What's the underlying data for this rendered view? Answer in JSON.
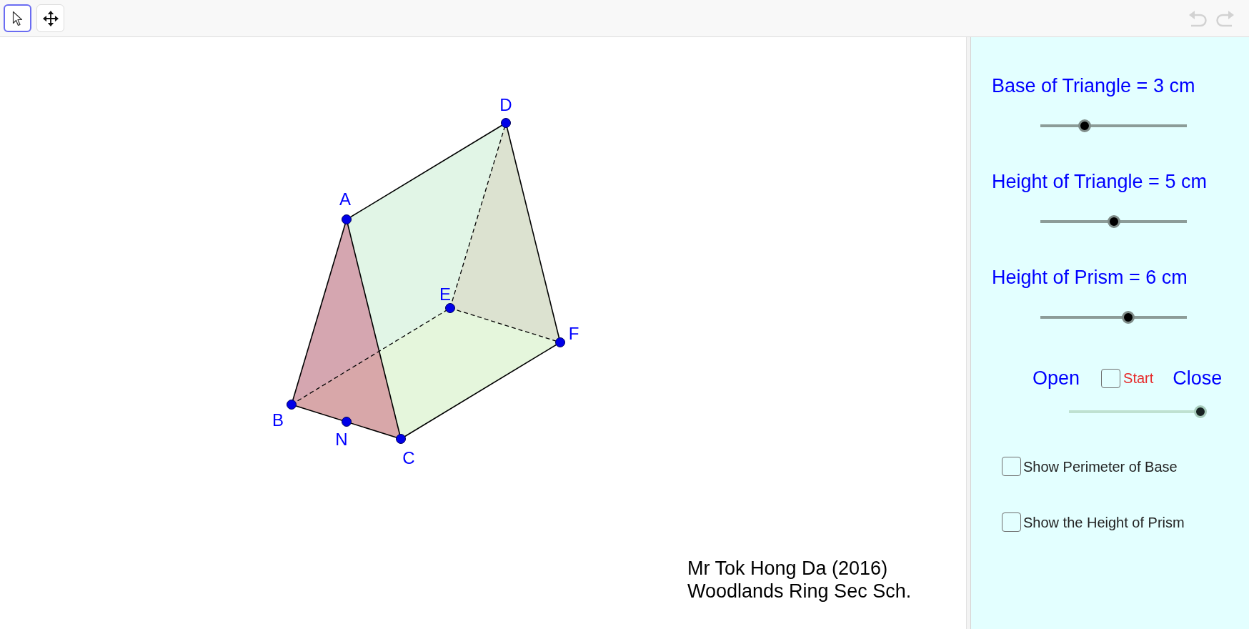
{
  "toolbar": {
    "tools": [
      {
        "kind": "select",
        "selected": true
      },
      {
        "kind": "move",
        "selected": false
      }
    ],
    "undo": {
      "disabled": true
    },
    "redo": {
      "disabled": true
    }
  },
  "canvas": {
    "points": [
      {
        "label": "D"
      },
      {
        "label": "A"
      },
      {
        "label": "E"
      },
      {
        "label": "F"
      },
      {
        "label": "B"
      },
      {
        "label": "N"
      },
      {
        "label": "C"
      }
    ],
    "credits": {
      "author": "Mr Tok Hong Da (2016)",
      "school": "Woodlands Ring Sec Sch."
    }
  },
  "panel": {
    "sliders": [
      {
        "label": "Base of Triangle = 3 cm",
        "level": 0.3
      },
      {
        "label": "Height of Triangle = 5 cm",
        "level": 0.5
      },
      {
        "label": "Height of Prism = 6 cm",
        "level": 0.6
      }
    ],
    "animation": {
      "open_label": "Open",
      "start": {
        "label": "Start",
        "checked": false
      },
      "close_label": "Close",
      "level": 1
    },
    "checkboxes": [
      {
        "label": "Show Perimeter of Base",
        "checked": false
      },
      {
        "label": "Show the Height of Prism",
        "checked": false
      }
    ]
  }
}
